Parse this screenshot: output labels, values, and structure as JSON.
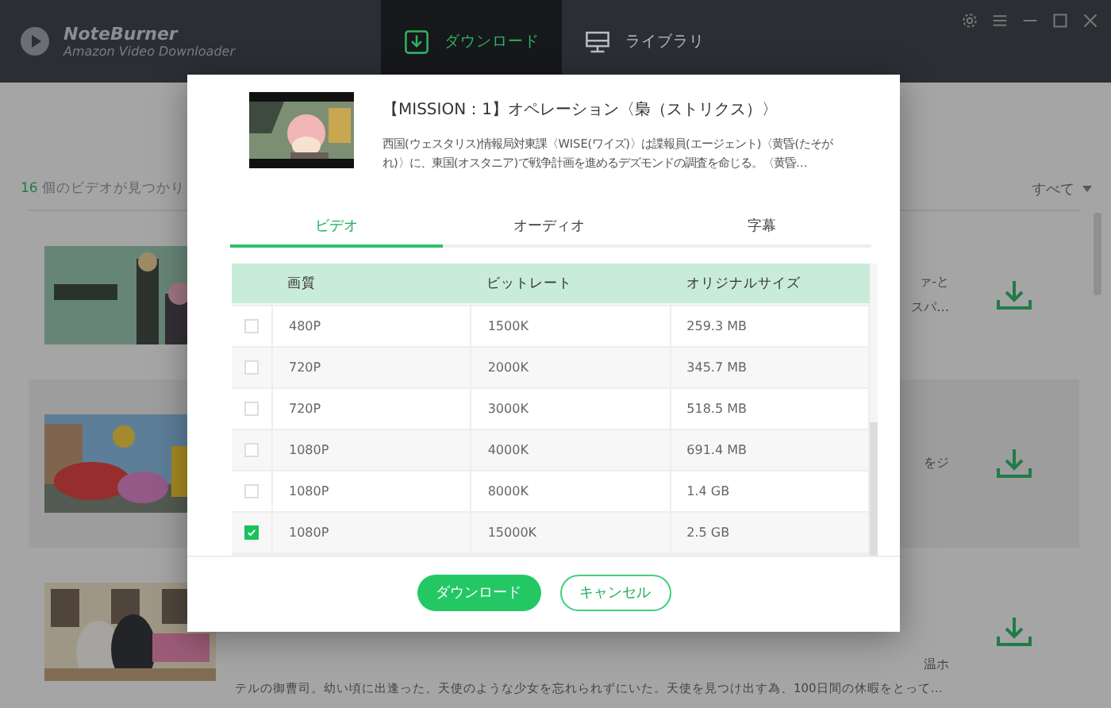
{
  "app": {
    "name": "NoteBurner",
    "subtitle": "Amazon Video Downloader"
  },
  "nav_tabs": [
    {
      "label": "ダウンロード",
      "selected": true,
      "kind": "download"
    },
    {
      "label": "ライブラリ",
      "selected": false,
      "kind": "library"
    }
  ],
  "results": {
    "count": "16",
    "count_text": "個のビデオが見つかり",
    "filter": "すべて"
  },
  "videos": [
    {
      "lines": [
        "ァ‐と",
        "スパ…"
      ]
    },
    {
      "lines": [
        "をジ"
      ]
    },
    {
      "lines": [
        "温ホ"
      ],
      "long_line": "テルの御曹司。幼い頃に出逢った、天使のような少女を忘れられずにいた。天使を見つけ出す為、100日間の休暇をとって…"
    }
  ],
  "dialog": {
    "title": "【MISSION：1】オペレーション〈梟（ストリクス）〉",
    "description": "西国(ウェスタリス)情報局対東課〈WISE(ワイズ)〉は諜報員(エージェント)〈黄昏(たそがれ)〉に、東国(オスタニア)で戦争計画を進めるデズモンドの調査を命じる。〈黄昏…",
    "tabs": [
      {
        "label": "ビデオ",
        "selected": true
      },
      {
        "label": "オーディオ",
        "selected": false
      },
      {
        "label": "字幕",
        "selected": false
      }
    ],
    "table": {
      "columns": [
        "画質",
        "ビットレート",
        "オリジナルサイズ"
      ],
      "rows": [
        {
          "quality": "480P",
          "bitrate": "1500K",
          "size": "259.3 MB",
          "checked": false
        },
        {
          "quality": "720P",
          "bitrate": "2000K",
          "size": "345.7 MB",
          "checked": false
        },
        {
          "quality": "720P",
          "bitrate": "3000K",
          "size": "518.5 MB",
          "checked": false
        },
        {
          "quality": "1080P",
          "bitrate": "4000K",
          "size": "691.4 MB",
          "checked": false
        },
        {
          "quality": "1080P",
          "bitrate": "8000K",
          "size": "1.4 GB",
          "checked": false
        },
        {
          "quality": "1080P",
          "bitrate": "15000K",
          "size": "2.5 GB",
          "checked": true
        }
      ]
    },
    "buttons": [
      {
        "label": "ダウンロード",
        "kind": "primary"
      },
      {
        "label": "キャンセル",
        "kind": "secondary"
      }
    ]
  }
}
